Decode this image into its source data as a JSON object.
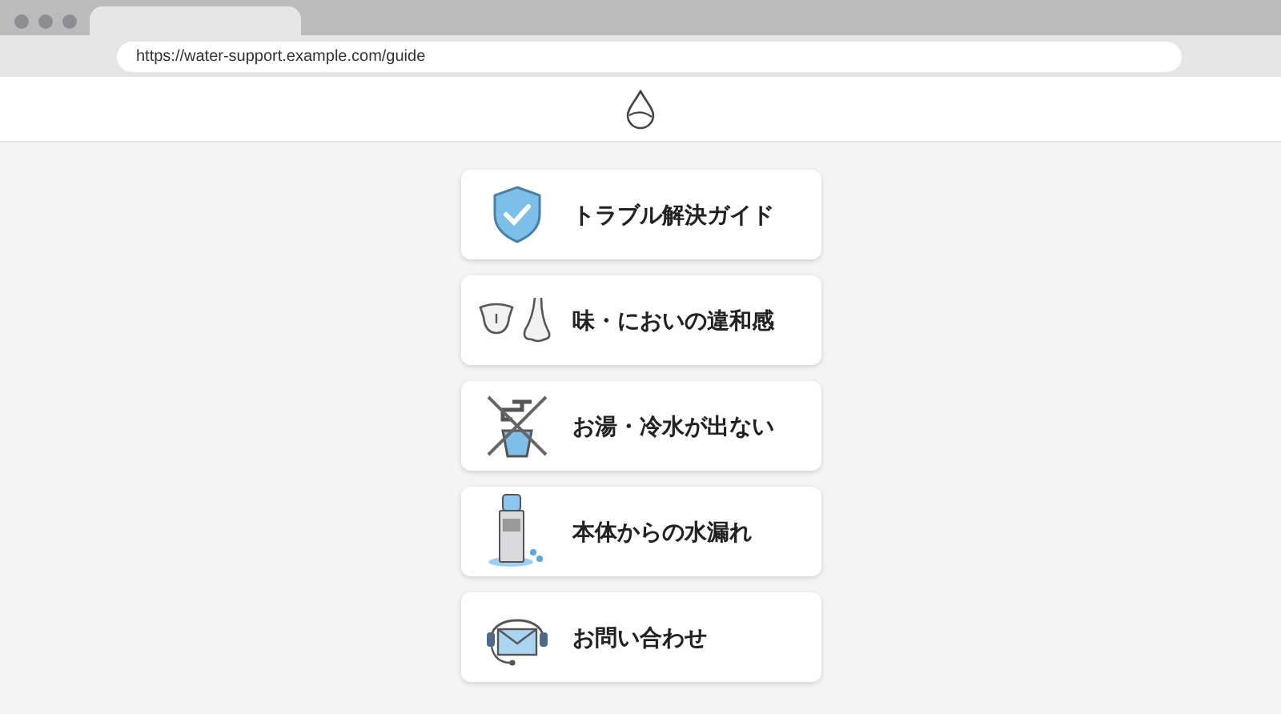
{
  "browser": {
    "url": "https://water-support.example.com/guide"
  },
  "menu": [
    {
      "kind": "shield",
      "label": "トラブル解決ガイド"
    },
    {
      "kind": "taste",
      "label": "味・においの違和感"
    },
    {
      "kind": "nowater",
      "label": "お湯・冷水が出ない"
    },
    {
      "kind": "leak",
      "label": "本体からの水漏れ"
    },
    {
      "kind": "contact",
      "label": "お問い合わせ"
    }
  ]
}
